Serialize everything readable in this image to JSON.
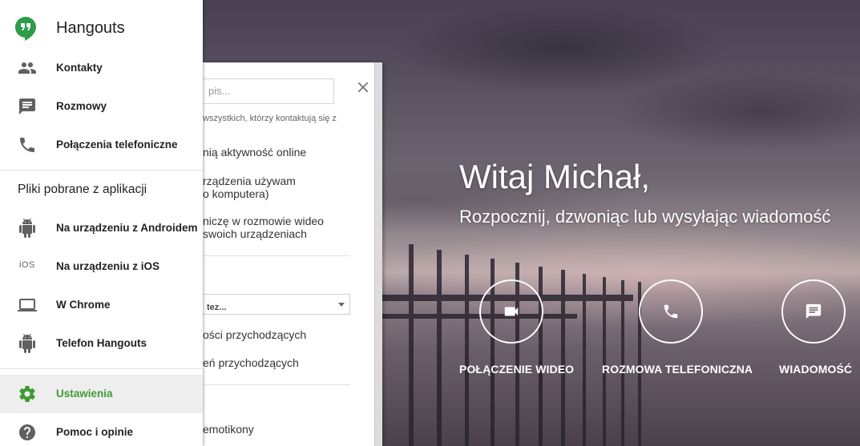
{
  "app": {
    "title": "Hangouts"
  },
  "nav": {
    "main_items": [
      {
        "label": "Kontakty",
        "icon": "people-icon"
      },
      {
        "label": "Rozmowy",
        "icon": "chat-icon"
      },
      {
        "label": "Połączenia telefoniczne",
        "icon": "phone-icon"
      }
    ],
    "downloads_title": "Pliki pobrane z aplikacji",
    "download_items": [
      {
        "label": "Na urządzeniu z Androidem",
        "icon": "android-icon"
      },
      {
        "label": "Na urządzeniu z iOS",
        "icon": "ios-icon",
        "icon_text": "iOS"
      },
      {
        "label": "W Chrome",
        "icon": "laptop-icon"
      },
      {
        "label": "Telefon Hangouts",
        "icon": "android-icon"
      }
    ],
    "bottom_items": [
      {
        "label": "Ustawienia",
        "icon": "gear-icon",
        "active": true
      },
      {
        "label": "Pomoc i opinie",
        "icon": "help-icon"
      }
    ]
  },
  "settings_panel": {
    "status_placeholder": "pis...",
    "status_note": "wszystkich, którzy kontaktują się z",
    "option_online": "nią aktywność online",
    "option_devices_l1": "rządzenia używam",
    "option_devices_l2": "o komputera)",
    "option_video_l1": "niczę w rozmowie wideo",
    "option_video_l2": "swoich urządzeniach",
    "select_value": "tez...",
    "incoming_messages": "ości przychodzących",
    "incoming_calls": "eń przychodzących",
    "emoticons": "emotikony"
  },
  "welcome": {
    "title": "Witaj Michał,",
    "subtitle": "Rozpocznij, dzwoniąc lub wysyłając wiadomość"
  },
  "actions": [
    {
      "label": "POŁĄCZENIE WIDEO",
      "icon": "videocam-icon"
    },
    {
      "label": "ROZMOWA TELEFONICZNA",
      "icon": "phone-icon"
    },
    {
      "label": "WIADOMOŚĆ",
      "icon": "message-icon"
    }
  ],
  "colors": {
    "accent": "#3d9b35",
    "drawer_bg": "#ffffff",
    "active_bg": "#eeeeee"
  }
}
